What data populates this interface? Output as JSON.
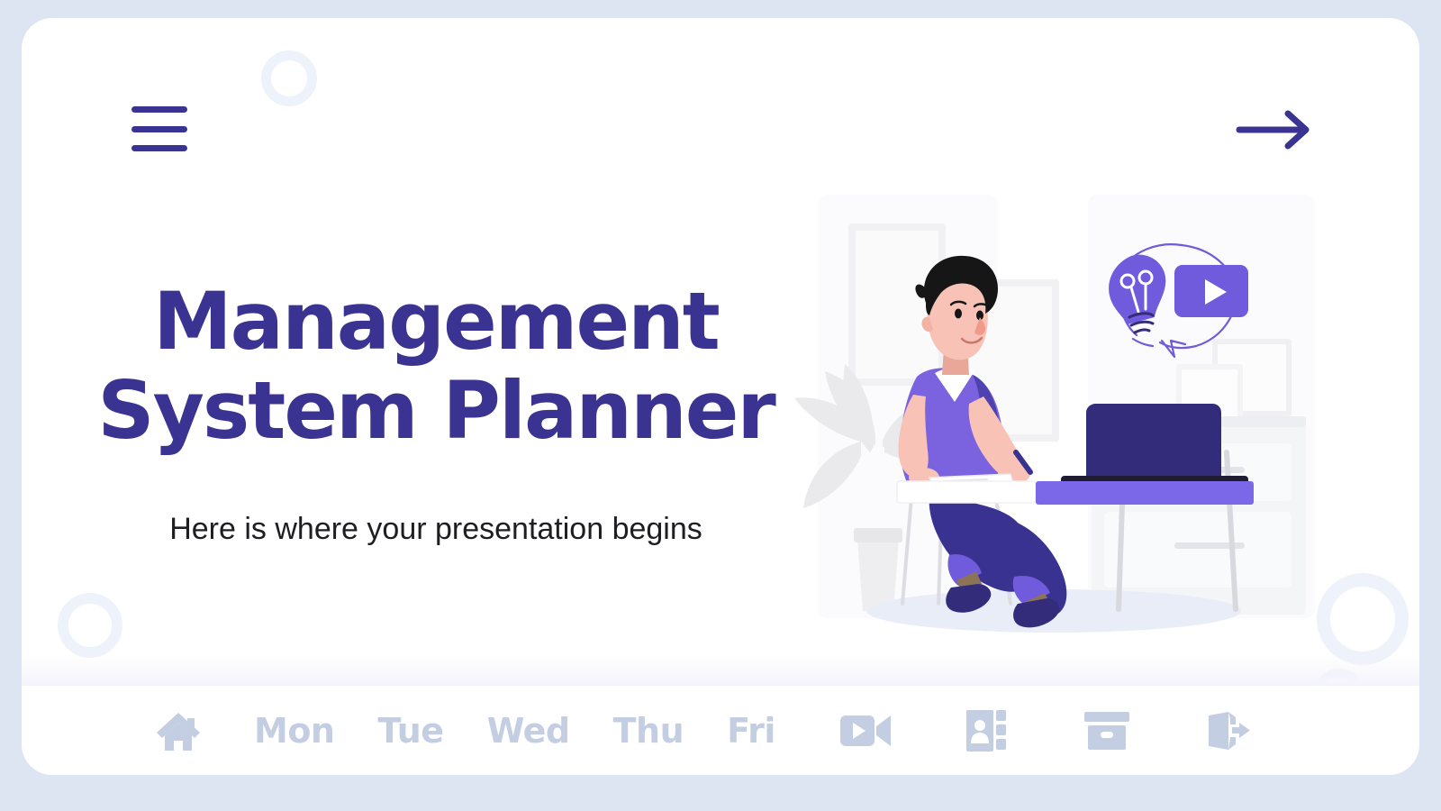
{
  "slide": {
    "title": "Management System Planner",
    "subtitle": "Here is where your presentation begins"
  },
  "topbar": {
    "menu_label": "menu",
    "next_label": "next"
  },
  "nav": {
    "home_label": "Home",
    "days": [
      "Mon",
      "Tue",
      "Wed",
      "Thu",
      "Fri"
    ],
    "icons": [
      {
        "name": "video-camera-icon",
        "label": "Video"
      },
      {
        "name": "address-book-icon",
        "label": "Contacts"
      },
      {
        "name": "archive-box-icon",
        "label": "Archive"
      },
      {
        "name": "exit-door-icon",
        "label": "Exit"
      }
    ]
  },
  "illustration": {
    "name": "person-working-at-desk-illustration",
    "elements": [
      "thought-bubble",
      "lightbulb-icon",
      "video-play-icon",
      "laptop",
      "desk",
      "stool",
      "potted-plant",
      "picture-frames",
      "cabinet"
    ]
  },
  "colors": {
    "page_background": "#dde4f2",
    "card_background": "#ffffff",
    "title": "#3b3392",
    "subtitle": "#1d1d22",
    "accent_purple": "#7b68e8",
    "deep_indigo": "#332c7a",
    "nav_inactive": "#c4cee2",
    "ring": "#eef2fb"
  }
}
